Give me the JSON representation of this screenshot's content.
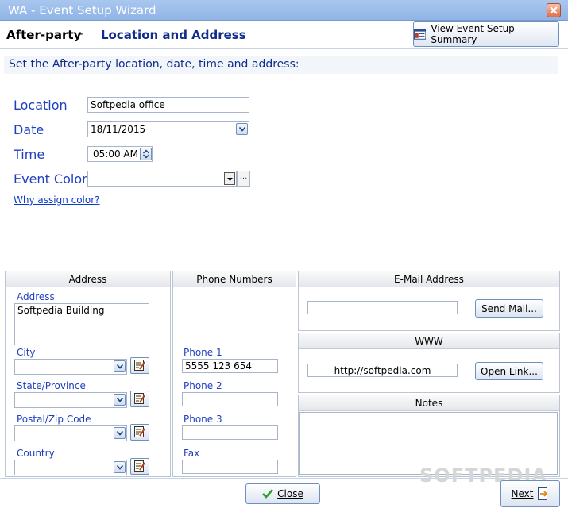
{
  "window": {
    "title": "WA - Event Setup Wizard"
  },
  "header": {
    "step_name": "After-party",
    "separator": "-",
    "step_title": "Location and Address",
    "summary_button": "View Event Setup Summary"
  },
  "instruction": "Set the After-party  location, date, time and address:",
  "form": {
    "location_label": "Location",
    "location_value": "Softpedia office",
    "date_label": "Date",
    "date_value": "18/11/2015",
    "time_label": "Time",
    "time_value": "05:00 AM",
    "color_label": "Event Color",
    "color_value": "",
    "color_more": "...",
    "why_link": "Why assign color?"
  },
  "address": {
    "header": "Address",
    "address_label": "Address",
    "address_value": "Softpedia Building",
    "city_label": "City",
    "state_label": "State/Province",
    "postal_label": "Postal/Zip Code",
    "country_label": "Country"
  },
  "phones": {
    "header": "Phone Numbers",
    "phone1_label": "Phone 1",
    "phone1_value": "5555 123 654",
    "phone2_label": "Phone 2",
    "phone3_label": "Phone 3",
    "fax_label": "Fax"
  },
  "email": {
    "header": "E-Mail Address",
    "value": "",
    "send_button": "Send Mail..."
  },
  "www": {
    "header": "WWW",
    "value": "http://softpedia.com",
    "open_button": "Open Link..."
  },
  "notes": {
    "header": "Notes",
    "value": ""
  },
  "footer": {
    "close_button": "Close",
    "next_button": "Next"
  },
  "watermark": "SOFTPEDIA",
  "colors": {
    "label_blue": "#1f3fbf",
    "title_blue": "#0f2d8c",
    "link_blue": "#0b3cc9"
  }
}
